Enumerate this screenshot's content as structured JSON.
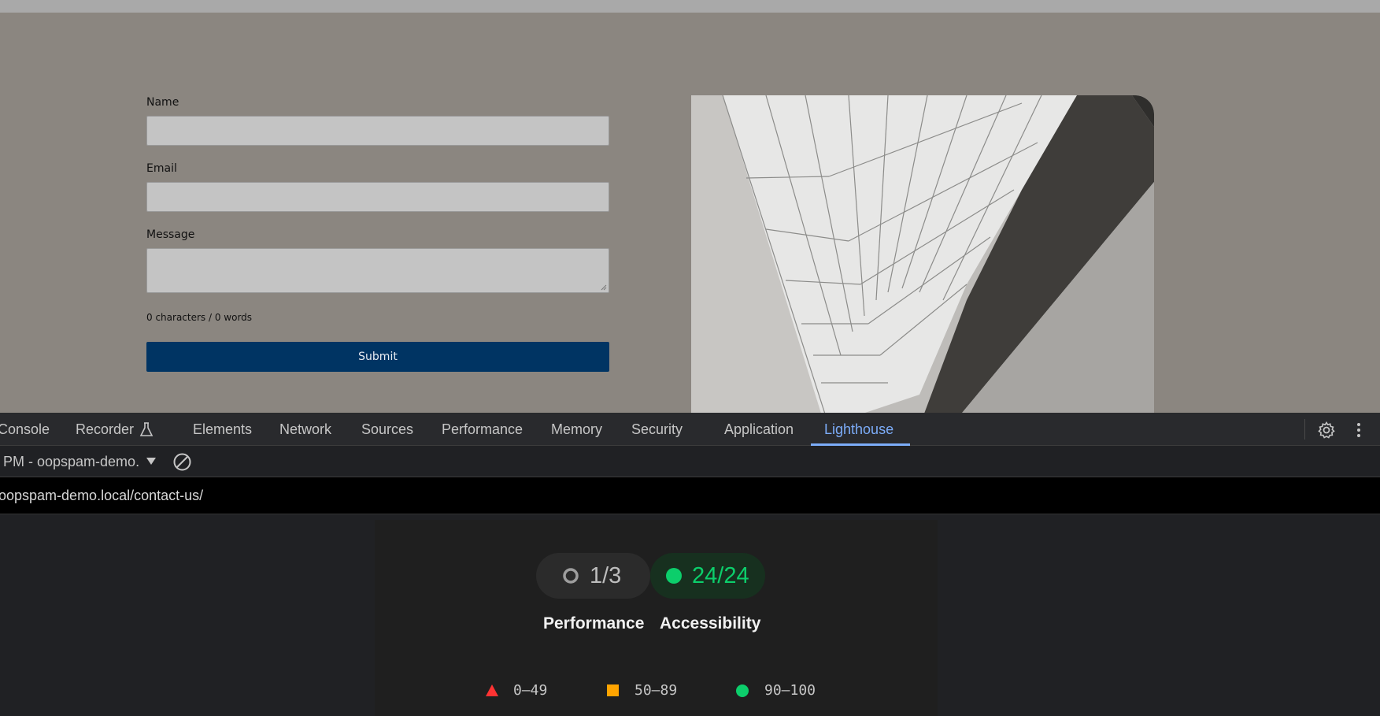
{
  "page": {
    "form": {
      "name_label": "Name",
      "name_value": "",
      "email_label": "Email",
      "email_value": "",
      "message_label": "Message",
      "message_value": "",
      "counter": "0 characters / 0 words",
      "submit_label": "Submit"
    }
  },
  "devtools": {
    "tabs": [
      {
        "label": "Console"
      },
      {
        "label": "Recorder"
      },
      {
        "label": "Elements"
      },
      {
        "label": "Network"
      },
      {
        "label": "Sources"
      },
      {
        "label": "Performance"
      },
      {
        "label": "Memory"
      },
      {
        "label": "Security"
      },
      {
        "label": "Application"
      },
      {
        "label": "Lighthouse"
      }
    ],
    "active_tab": "Lighthouse",
    "report_select": "PM - oopspam-demo.",
    "url": "oopspam-demo.local/contact-us/",
    "accent_color": "#7cacf8"
  },
  "report": {
    "pills": [
      {
        "value": "1/3",
        "status": "neutral"
      },
      {
        "value": "24/24",
        "status": "pass",
        "color": "#0cce6b"
      }
    ],
    "categories": [
      "Performance",
      "Accessibility"
    ],
    "legend": [
      {
        "range": "0–49",
        "shape": "triangle",
        "color": "#ff3333"
      },
      {
        "range": "50–89",
        "shape": "square",
        "color": "#ffa400"
      },
      {
        "range": "90–100",
        "shape": "circle",
        "color": "#0cce6b"
      }
    ]
  }
}
